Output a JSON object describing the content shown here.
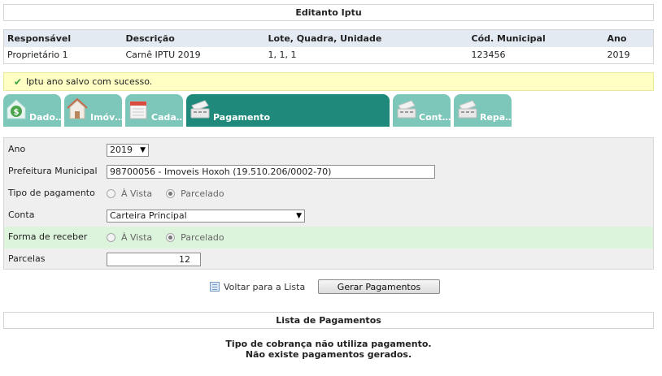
{
  "page_title": "Editanto Iptu",
  "info_table": {
    "headers": [
      "Responsável",
      "Descrição",
      "Lote, Quadra, Unidade",
      "Cód. Municipal",
      "Ano"
    ],
    "row": [
      "Proprietário 1",
      "Carnê IPTU 2019",
      "1, 1, 1",
      "123456",
      "2019"
    ]
  },
  "success_message": "Iptu ano salvo com sucesso.",
  "tabs": [
    {
      "label": "Dado…",
      "icon": "money-house-icon",
      "active": false
    },
    {
      "label": "Imóv…",
      "icon": "house-icon",
      "active": false
    },
    {
      "label": "Cada…",
      "icon": "calendar-house-icon",
      "active": false
    },
    {
      "label": "Pagamento",
      "icon": "cash-register-icon",
      "active": true
    },
    {
      "label": "Cont…",
      "icon": "cash-register-icon",
      "active": false
    },
    {
      "label": "Repa…",
      "icon": "cash-register-icon",
      "active": false
    }
  ],
  "form": {
    "ano": {
      "label": "Ano",
      "value": "2019"
    },
    "prefeitura": {
      "label": "Prefeitura Municipal",
      "value": "98700056 - Imoveis Hoxoh (19.510.206/0002-70)"
    },
    "tipo_pagamento": {
      "label": "Tipo de pagamento",
      "options": [
        "À Vista",
        "Parcelado"
      ],
      "selected": "Parcelado"
    },
    "conta": {
      "label": "Conta",
      "value": "Carteira Principal"
    },
    "forma_receber": {
      "label": "Forma de receber",
      "options": [
        "À Vista",
        "Parcelado"
      ],
      "selected": "Parcelado"
    },
    "parcelas": {
      "label": "Parcelas",
      "value": "12"
    }
  },
  "actions": {
    "back_label": "Voltar para a Lista",
    "generate_label": "Gerar Pagamentos"
  },
  "payments": {
    "title": "Lista de Pagamentos",
    "message_line1": "Tipo de cobrança não utiliza pagamento.",
    "message_line2": "Não existe pagamentos gerados."
  },
  "colors": {
    "tab_inactive": "#7cc7b9",
    "tab_active": "#1f8a7b",
    "success_bg": "#ffffc4",
    "highlight_row": "#dcf3dc",
    "table_header_bg": "#e4eaf2"
  }
}
